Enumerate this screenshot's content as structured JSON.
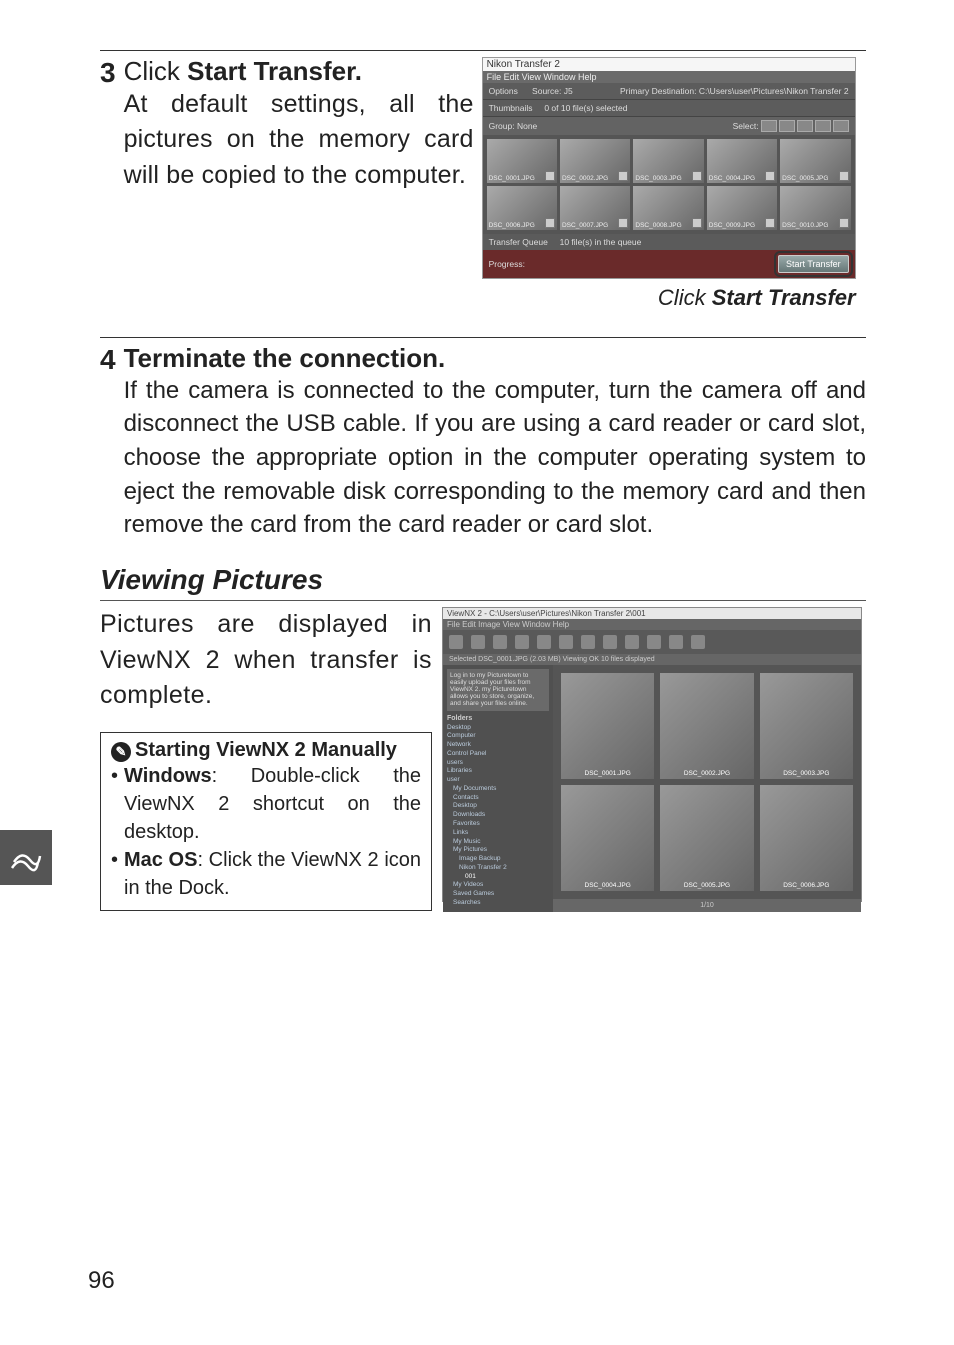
{
  "step3": {
    "num": "3",
    "title_prefix": "Click ",
    "title_bold": "Start Transfer.",
    "body": "At default settings, all the pictures on the memory card will be copied to the computer.",
    "caption_prefix": "Click ",
    "caption_bold": "Start Transfer"
  },
  "transfer_window": {
    "app_title": "Nikon Transfer 2",
    "menu": "File  Edit  View  Window  Help",
    "options_label": "Options",
    "source_label": "Source: J5",
    "dest_label": "Primary Destination: C:\\Users\\user\\Pictures\\Nikon Transfer 2",
    "thumbnails_label": "Thumbnails",
    "thumbnails_info": "0 of 10 file(s) selected",
    "group_label": "Group:",
    "group_value": "None",
    "select_label": "Select:",
    "thumbs": [
      "DSC_0001.JPG",
      "DSC_0002.JPG",
      "DSC_0003.JPG",
      "DSC_0004.JPG",
      "DSC_0005.JPG",
      "DSC_0006.JPG",
      "DSC_0007.JPG",
      "DSC_0008.JPG",
      "DSC_0009.JPG",
      "DSC_0010.JPG"
    ],
    "queue_label": "Transfer Queue",
    "queue_info": "10 file(s) in the queue",
    "progress_label": "Progress:",
    "start_button": "Start Transfer"
  },
  "step4": {
    "num": "4",
    "title": "Terminate the connection.",
    "body": "If the camera is connected to the computer, turn the camera off and disconnect the USB cable. If you are using a card reader or card slot, choose the appropriate option in the computer operating system to eject the removable disk corresponding to the memory card and then remove the card from the card reader or card slot."
  },
  "viewing": {
    "heading": "Viewing Pictures",
    "body": "Pictures are displayed in ViewNX 2 when transfer is complete."
  },
  "aside": {
    "title": "Starting ViewNX 2 Manually",
    "items": [
      {
        "os": "Windows",
        "text": ": Double-click the ViewNX 2 shortcut on the desktop."
      },
      {
        "os": "Mac OS",
        "text": ": Click the ViewNX 2 icon in the Dock."
      }
    ]
  },
  "viewnx_window": {
    "titlebar": "ViewNX 2 - C:\\Users\\user\\Pictures\\Nikon Transfer 2\\001",
    "menu": "File  Edit  Image  View  Window  Help",
    "crumb": "Selected  DSC_0001.JPG (2.03 MB)  Viewing OK  10 files displayed",
    "tip": "Log in to my Picturetown to easily upload your files from ViewNX 2. my Picturetown allows you to store, organize, and share your files online.",
    "folders_label": "Folders",
    "tree": [
      "Desktop",
      "Computer",
      "Network",
      "Control Panel",
      "users",
      "Libraries",
      "user",
      "My Documents",
      "Contacts",
      "Desktop",
      "Downloads",
      "Favorites",
      "Links",
      "My Music",
      "My Pictures",
      "Image Backup",
      "Nikon Transfer 2",
      "001",
      "My Videos",
      "Saved Games",
      "Searches"
    ],
    "thumbs": [
      "DSC_0001.JPG",
      "DSC_0002.JPG",
      "DSC_0003.JPG",
      "DSC_0004.JPG",
      "DSC_0005.JPG",
      "DSC_0006.JPG"
    ],
    "status": "1/10"
  },
  "page_number": "96"
}
